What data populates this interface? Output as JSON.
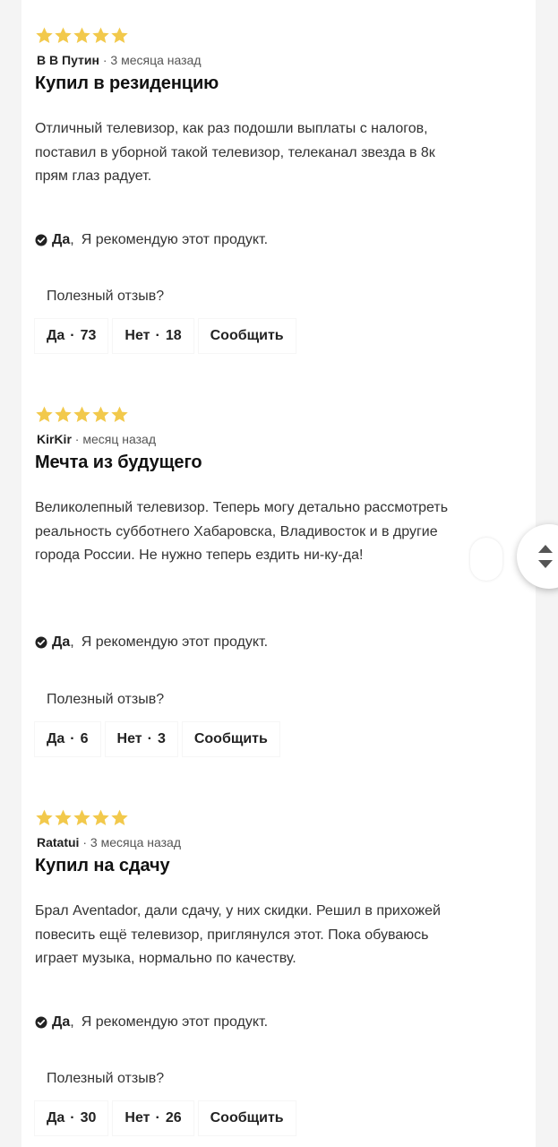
{
  "reviews": [
    {
      "rating": 5,
      "author": "В В Путин",
      "time": "· 3 месяца назад",
      "title": "Купил в резиденцию",
      "body": "Отличный телевизор, как раз подошли выплаты с налогов, поставил в уборной такой телевизор, телеканал звезда в 8к прям глаз радует.",
      "recommend_yes": "Да",
      "recommend_comma": ",",
      "recommend_text": "Я рекомендую этот продукт.",
      "helpful_label": "Полезный отзыв?",
      "yes_label": "Да",
      "yes_count": "73",
      "no_label": "Нет",
      "no_count": "18",
      "report_label": "Сообщить"
    },
    {
      "rating": 5,
      "author": "KirKir",
      "time": "· месяц назад",
      "title": "Мечта из будущего",
      "body": "Великолепный телевизор. Теперь могу детально рассмотреть реальность субботнего Хабаровска, Владивосток и в другие города России. Не нужно теперь ездить ни-ку-да!",
      "recommend_yes": "Да",
      "recommend_comma": ",",
      "recommend_text": "Я рекомендую этот продукт.",
      "helpful_label": "Полезный отзыв?",
      "yes_label": "Да",
      "yes_count": "6",
      "no_label": "Нет",
      "no_count": "3",
      "report_label": "Сообщить"
    },
    {
      "rating": 5,
      "author": "Ratatui",
      "time": "· 3 месяца назад",
      "title": "Купил на сдачу",
      "body": "Брал Aventador, дали сдачу, у них скидки. Решил в прихожей повесить ещё телевизор, приглянулся этот. Пока обуваюсь играет музыка, нормально по качеству.",
      "recommend_yes": "Да",
      "recommend_comma": ",",
      "recommend_text": "Я рекомендую этот продукт.",
      "helpful_label": "Полезный отзыв?",
      "yes_label": "Да",
      "yes_count": "30",
      "no_label": "Нет",
      "no_count": "26",
      "report_label": "Сообщить"
    }
  ],
  "vote_separator": "·",
  "colors": {
    "star": "#f2c94c",
    "background": "#f4f4f4",
    "card": "#ffffff",
    "text": "#333333"
  },
  "icons": {
    "star": "star-icon",
    "check": "check-circle-icon",
    "scroll_up": "arrow-up-icon",
    "scroll_down": "arrow-down-icon"
  }
}
